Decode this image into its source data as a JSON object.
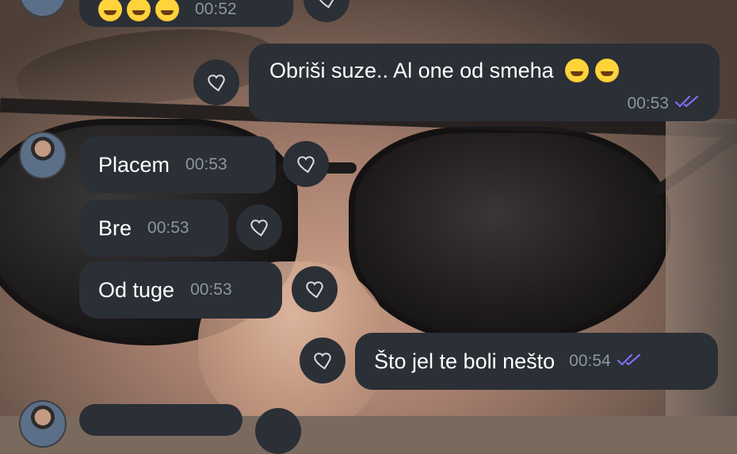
{
  "colors": {
    "bubble": "#2b2f36",
    "text": "#ffffff",
    "time": "#8e96a1",
    "read_ticks": "#7b6ff0"
  },
  "messages": [
    {
      "side": "incoming",
      "text": "",
      "emoji": [
        "laughing-crying",
        "laughing-crying",
        "laughing-crying"
      ],
      "time": "00:52"
    },
    {
      "side": "outgoing",
      "text": "Obriši suze.. Al one od smeha",
      "emoji": [
        "rolling-laughing",
        "rolling-laughing"
      ],
      "time": "00:53",
      "status": "read"
    },
    {
      "side": "incoming",
      "text": "Placem",
      "time": "00:53"
    },
    {
      "side": "incoming",
      "text": "Bre",
      "time": "00:53"
    },
    {
      "side": "incoming",
      "text": "Od tuge",
      "time": "00:53"
    },
    {
      "side": "outgoing",
      "text": "Što jel te boli nešto",
      "time": "00:54",
      "status": "read"
    }
  ]
}
